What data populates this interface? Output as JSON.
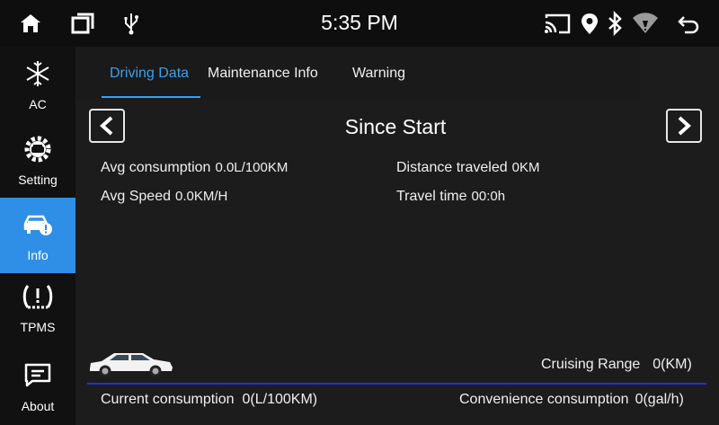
{
  "status_bar": {
    "time": "5:35 PM",
    "icons": [
      "home-icon",
      "recent-apps-icon",
      "usb-icon",
      "cast-icon",
      "location-icon",
      "bluetooth-icon",
      "wifi-icon",
      "back-icon"
    ]
  },
  "sidebar": {
    "active": "Info",
    "items": [
      {
        "label": "AC",
        "icon": "snowflake-icon"
      },
      {
        "label": "Setting",
        "icon": "car-gear-icon"
      },
      {
        "label": "Info",
        "icon": "car-info-icon"
      },
      {
        "label": "TPMS",
        "icon": "tire-pressure-icon"
      },
      {
        "label": "About",
        "icon": "message-icon"
      }
    ]
  },
  "tabs": {
    "active": "Driving Data",
    "items": [
      {
        "label": "Driving Data"
      },
      {
        "label": "Maintenance Info"
      },
      {
        "label": "Warning"
      }
    ]
  },
  "panel": {
    "title": "Since Start",
    "avg_consumption": {
      "label": "Avg consumption",
      "value": "0.0L/100KM"
    },
    "avg_speed": {
      "label": "Avg Speed",
      "value": "0.0KM/H"
    },
    "distance": {
      "label": "Distance traveled",
      "value": "0KM"
    },
    "travel_time": {
      "label": "Travel time",
      "value": "00:0h"
    },
    "cruising_range": {
      "label": "Cruising Range",
      "value": "0(KM)"
    },
    "current_consumption": {
      "label": "Current consumption",
      "value": "0(L/100KM)"
    },
    "convenience_consumption": {
      "label": "Convenience consumption",
      "value": "0(gal/h)"
    }
  },
  "colors": {
    "accent": "#3aa0f0",
    "active_side": "#2f8fe6",
    "divider": "#2a2fd0",
    "background": "#1c1c1c"
  }
}
